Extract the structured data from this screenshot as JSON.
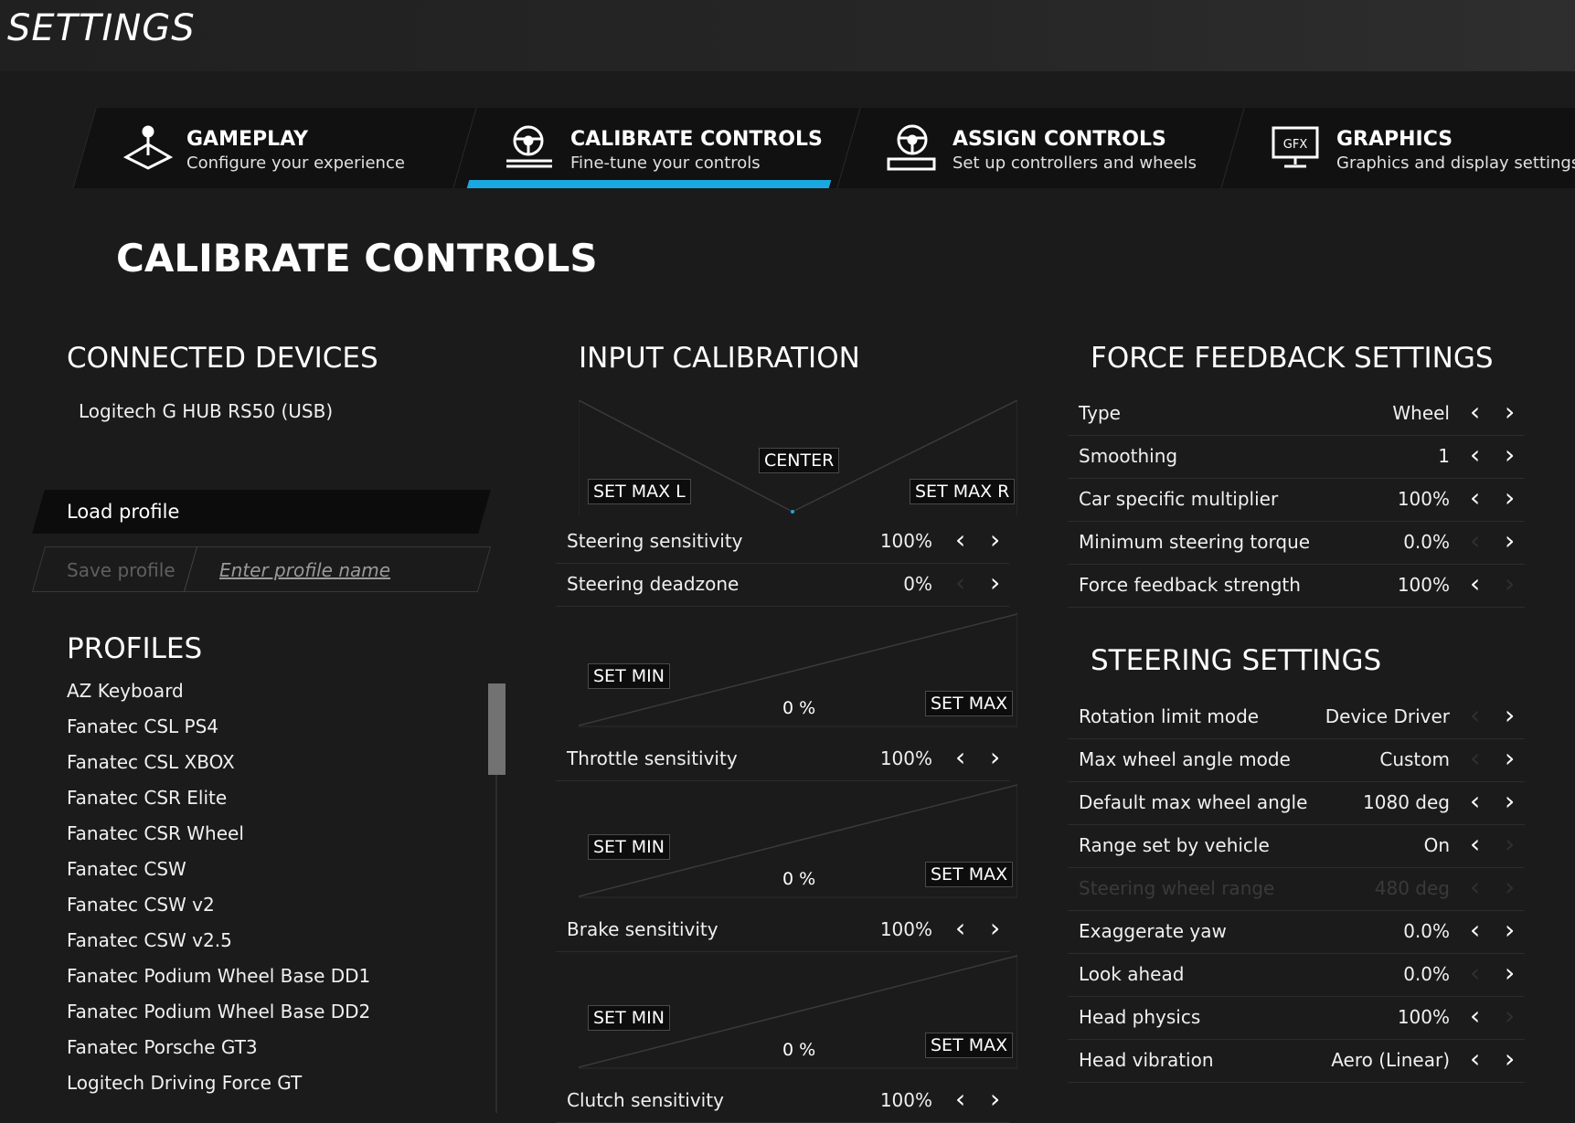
{
  "header": {
    "title": "SETTINGS"
  },
  "tabs": [
    {
      "title": "GAMEPLAY",
      "subtitle": "Configure your experience",
      "icon": "joystick-icon",
      "active": false
    },
    {
      "title": "CALIBRATE CONTROLS",
      "subtitle": "Fine-tune your controls",
      "icon": "steering-wheel-sliders-icon",
      "active": true
    },
    {
      "title": "ASSIGN CONTROLS",
      "subtitle": "Set up controllers and wheels",
      "icon": "steering-wheel-keyboard-icon",
      "active": false
    },
    {
      "title": "GRAPHICS",
      "subtitle": "Graphics and display settings",
      "icon": "gfx-monitor-icon",
      "active": false
    }
  ],
  "page_title": "CALIBRATE CONTROLS",
  "connected_devices": {
    "heading": "CONNECTED DEVICES",
    "device": "Logitech G HUB RS50 (USB)",
    "load_profile": "Load profile",
    "save_profile": "Save profile",
    "profile_name_placeholder": "Enter profile name"
  },
  "profiles": {
    "heading": "PROFILES",
    "items": [
      "AZ Keyboard",
      "Fanatec CSL PS4",
      "Fanatec CSL XBOX",
      "Fanatec CSR Elite",
      "Fanatec CSR Wheel",
      "Fanatec CSW",
      "Fanatec CSW v2",
      "Fanatec CSW v2.5",
      "Fanatec Podium Wheel Base DD1",
      "Fanatec Podium Wheel Base DD2",
      "Fanatec Porsche GT3",
      "Logitech Driving Force GT"
    ]
  },
  "input_calibration": {
    "heading": "INPUT CALIBRATION",
    "steering": {
      "center": "CENTER",
      "set_max_l": "SET MAX L",
      "set_max_r": "SET MAX R"
    },
    "throttle": {
      "set_min": "SET MIN",
      "set_max": "SET MAX",
      "value": "0 %"
    },
    "brake": {
      "set_min": "SET MIN",
      "set_max": "SET MAX",
      "value": "0 %"
    },
    "clutch": {
      "set_min": "SET MIN",
      "set_max": "SET MAX",
      "value": "0 %"
    },
    "rows": {
      "steering_sensitivity": {
        "label": "Steering sensitivity",
        "value": "100%"
      },
      "steering_deadzone": {
        "label": "Steering deadzone",
        "value": "0%"
      },
      "throttle_sensitivity": {
        "label": "Throttle sensitivity",
        "value": "100%"
      },
      "brake_sensitivity": {
        "label": "Brake sensitivity",
        "value": "100%"
      },
      "clutch_sensitivity": {
        "label": "Clutch sensitivity",
        "value": "100%"
      }
    }
  },
  "force_feedback": {
    "heading": "FORCE FEEDBACK SETTINGS",
    "rows": [
      {
        "label": "Type",
        "value": "Wheel",
        "left_enabled": true,
        "right_enabled": true
      },
      {
        "label": "Smoothing",
        "value": "1",
        "left_enabled": true,
        "right_enabled": true
      },
      {
        "label": "Car specific multiplier",
        "value": "100%",
        "left_enabled": true,
        "right_enabled": true
      },
      {
        "label": "Minimum steering torque",
        "value": "0.0%",
        "left_enabled": false,
        "right_enabled": true
      },
      {
        "label": "Force feedback strength",
        "value": "100%",
        "left_enabled": true,
        "right_enabled": false
      }
    ]
  },
  "steering_settings": {
    "heading": "STEERING SETTINGS",
    "rows": [
      {
        "label": "Rotation limit mode",
        "value": "Device Driver",
        "left_enabled": false,
        "right_enabled": true
      },
      {
        "label": "Max wheel angle mode",
        "value": "Custom",
        "left_enabled": false,
        "right_enabled": true
      },
      {
        "label": "Default max wheel angle",
        "value": "1080 deg",
        "left_enabled": true,
        "right_enabled": true
      },
      {
        "label": "Range set by vehicle",
        "value": "On",
        "left_enabled": true,
        "right_enabled": false
      },
      {
        "label": "Steering wheel range",
        "value": "480 deg",
        "left_enabled": false,
        "right_enabled": false,
        "disabled": true
      },
      {
        "label": "Exaggerate yaw",
        "value": "0.0%",
        "left_enabled": true,
        "right_enabled": true
      },
      {
        "label": "Look ahead",
        "value": "0.0%",
        "left_enabled": false,
        "right_enabled": true
      },
      {
        "label": "Head physics",
        "value": "100%",
        "left_enabled": true,
        "right_enabled": false
      },
      {
        "label": "Head vibration",
        "value": "Aero (Linear)",
        "left_enabled": true,
        "right_enabled": true
      }
    ]
  },
  "colors": {
    "accent": "#1aa8e0",
    "background": "#1b1b1b",
    "panel": "#111111"
  }
}
